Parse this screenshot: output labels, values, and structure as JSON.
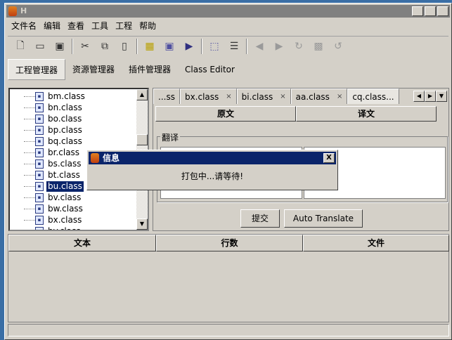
{
  "window": {
    "title": "H",
    "min": "_",
    "max": "□",
    "close": "X"
  },
  "menu": [
    "文件名",
    "编辑",
    "查看",
    "工具",
    "工程",
    "帮助"
  ],
  "toolbar": {
    "icons": [
      "new-file",
      "open",
      "save",
      "cut",
      "copy",
      "paste",
      "image",
      "frame",
      "run",
      "select",
      "export",
      "back",
      "forward",
      "refresh",
      "stop",
      "undo"
    ]
  },
  "tabs": [
    "工程管理器",
    "资源管理器",
    "插件管理器",
    "Class Editor"
  ],
  "tree": {
    "items": [
      "bm.class",
      "bn.class",
      "bo.class",
      "bp.class",
      "bq.class",
      "br.class",
      "bs.class",
      "bt.class",
      "bu.class",
      "bv.class",
      "bw.class",
      "bx.class",
      "by.class"
    ],
    "selected": "bu.class"
  },
  "file_tabs": [
    {
      "label": "...ss",
      "close": ""
    },
    {
      "label": "bx.class",
      "close": "×"
    },
    {
      "label": "bi.class",
      "close": "×"
    },
    {
      "label": "aa.class",
      "close": "×"
    },
    {
      "label": "cq.class...",
      "close": ""
    }
  ],
  "columns": {
    "original": "原文",
    "translation": "译文"
  },
  "translate_group": "翻译",
  "buttons": {
    "submit": "提交",
    "auto_translate": "Auto Translate"
  },
  "bottom_table": {
    "headers": [
      "文本",
      "行数",
      "文件"
    ]
  },
  "dialog": {
    "title": "信息",
    "message": "打包中...请等待!",
    "close": "X"
  }
}
